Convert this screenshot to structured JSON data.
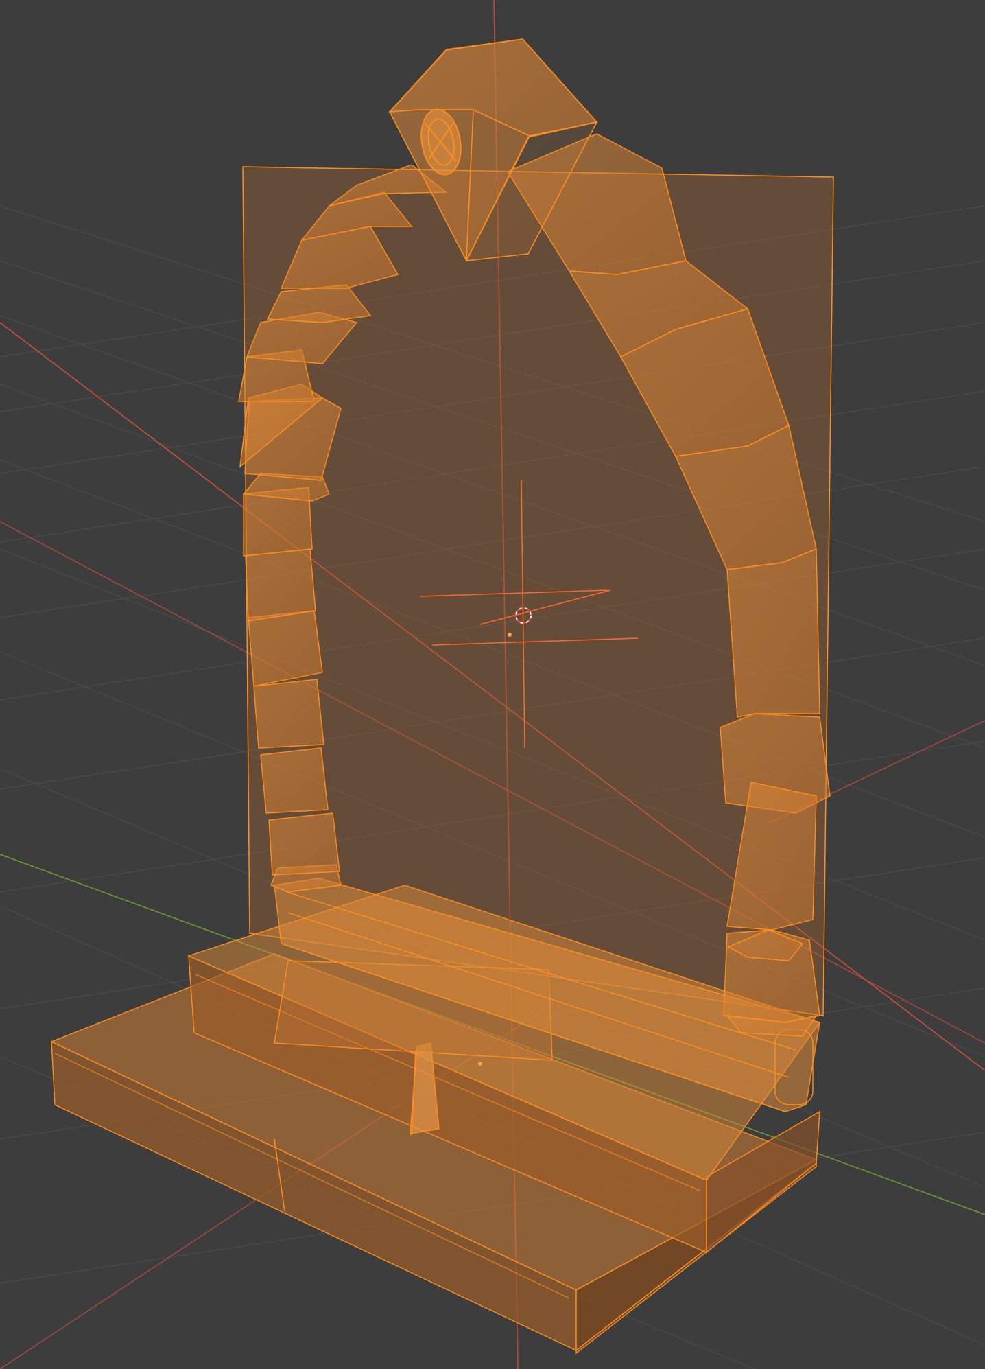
{
  "viewport": {
    "view": "3D Viewport",
    "shading": "wireframe-xray",
    "selection_state": "all-selected",
    "overlays": [
      "floor-grid",
      "x-axis-line",
      "y-axis-line",
      "z-axis-line",
      "3d-cursor",
      "object-origins"
    ]
  },
  "scene": {
    "object": "gothic-arch-doorway",
    "parts": [
      "backdrop-plane",
      "arch-blocks",
      "keystone",
      "keystone-ornament",
      "door-sill",
      "upper-step",
      "lower-step",
      "step-divider-posts"
    ]
  },
  "colors": {
    "background": "#3d3d3d",
    "grid_line": "#4a4a4a",
    "x_axis": "#c9503a",
    "y_axis": "#6b9a35",
    "selection_wire": "#ff8f1f",
    "selection_fill": "#d9843c",
    "cursor": "#ffffff"
  }
}
